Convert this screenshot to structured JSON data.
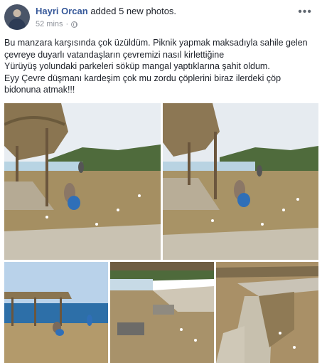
{
  "post": {
    "author": "Hayri Orcan",
    "action": "added 5 new photos.",
    "time": "52 mins",
    "separator": "·",
    "more_glyph": "•••"
  },
  "text_lines": [
    "Bu manzara karşısında çok üzüldüm. Piknik yapmak maksadıyla sahile gelen",
    "çevreye duyarlı vatandaşların çevremizi nasıl kirlettiğine",
    "Yürüyüş yolundaki parkeleri söküp mangal yaptıklarına şahit oldum.",
    "Eyy Çevre düşmanı kardeşim çok mu zordu çöplerini biraz ilerdeki çöp",
    "bidonuna atmak!!!"
  ],
  "photos": [
    {
      "subject": "sun-shelter-litter-worker"
    },
    {
      "subject": "sun-shelter-litter-worker-wide"
    },
    {
      "subject": "beach-shelter-workers"
    },
    {
      "subject": "broken-path-grill"
    },
    {
      "subject": "walkway-removed-pavers"
    }
  ],
  "icons": {
    "audience": "globe-icon",
    "menu": "more-options-icon"
  }
}
